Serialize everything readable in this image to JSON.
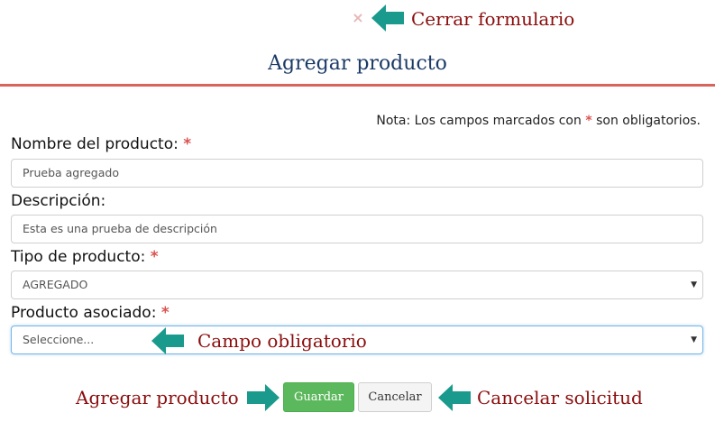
{
  "header": {
    "close_symbol": "×",
    "title": "Agregar producto"
  },
  "callouts": {
    "close": "Cerrar formulario",
    "required_field": "Campo obligatorio",
    "add": "Agregar producto",
    "cancel": "Cancelar solicitud",
    "arrow_color": "#1a9a8c",
    "text_color": "#8b0d0d"
  },
  "note": {
    "prefix": "Nota: Los campos marcados con",
    "asterisk": "*",
    "suffix": "son obligatorios."
  },
  "form": {
    "name": {
      "label": "Nombre del producto:",
      "required": "*",
      "value": "Prueba agregado"
    },
    "description": {
      "label": "Descripción:",
      "value": "Esta es una prueba de descripción"
    },
    "type": {
      "label": "Tipo de producto:",
      "required": "*",
      "selected": "AGREGADO"
    },
    "associated": {
      "label": "Producto asociado:",
      "required": "*",
      "selected": "Seleccione..."
    }
  },
  "buttons": {
    "save": "Guardar",
    "cancel": "Cancelar"
  },
  "icons": {
    "close": "close-icon",
    "caret": "chevron-down-icon",
    "callout_arrow": "arrow-left-icon"
  },
  "colors": {
    "title": "#1b3a66",
    "divider": "#d9645c",
    "required": "#d9534f",
    "save_button": "#5cb85c"
  }
}
